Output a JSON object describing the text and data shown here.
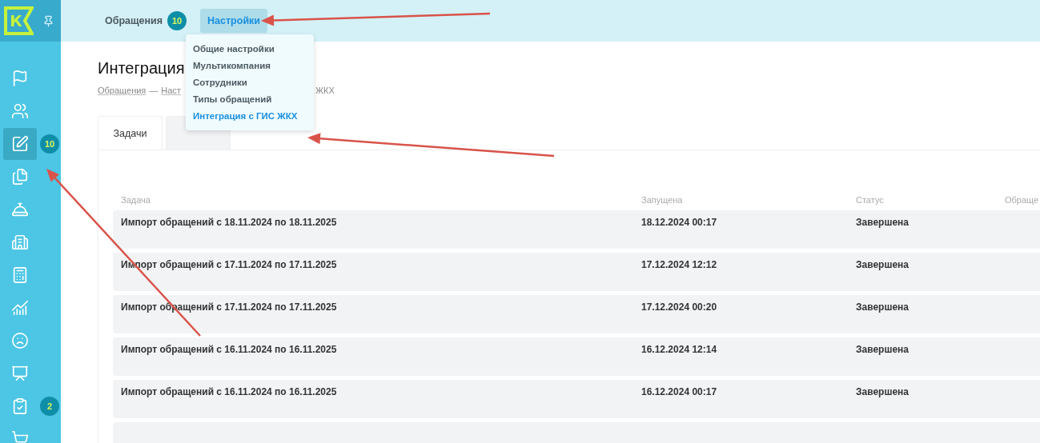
{
  "logo": {
    "letter": "К"
  },
  "sidebar": {
    "items": [
      {
        "selected": false
      },
      {
        "selected": false
      },
      {
        "selected": true,
        "badge": "10"
      },
      {
        "selected": false
      },
      {
        "selected": false
      },
      {
        "selected": false
      },
      {
        "selected": false
      },
      {
        "selected": false
      },
      {
        "selected": false
      },
      {
        "selected": false
      },
      {
        "selected": false,
        "badge": "2"
      },
      {
        "selected": false
      }
    ]
  },
  "top_nav": [
    {
      "label": "Обращения",
      "badge": "10",
      "selected": false
    },
    {
      "label": "Настройки",
      "selected": true
    }
  ],
  "dropdown": {
    "items": [
      {
        "label": "Общие настройки",
        "selected": false
      },
      {
        "label": "Мультикомпания",
        "selected": false
      },
      {
        "label": "Сотрудники",
        "selected": false
      },
      {
        "label": "Типы обращений",
        "selected": false
      },
      {
        "label": "Интеграция с ГИС ЖКХ",
        "selected": true
      }
    ]
  },
  "page": {
    "title": "Интеграция",
    "breadcrumbs": [
      "Обращения",
      "—",
      "Наст",
      "ЖКХ"
    ]
  },
  "tabs": [
    {
      "label": "Задачи",
      "selected": true
    },
    {
      "selected": false
    }
  ],
  "table": {
    "columns": [
      "Задача",
      "Запущена",
      "Статус",
      "Обраще"
    ],
    "rows": [
      [
        "Импорт обращений с 18.11.2024 по 18.11.2025",
        "18.12.2024 00:17",
        "Завершена"
      ],
      [
        "Импорт обращений с 17.11.2024 по 17.11.2025",
        "17.12.2024 12:12",
        "Завершена"
      ],
      [
        "Импорт обращений с 17.11.2024 по 17.11.2025",
        "17.12.2024 00:20",
        "Завершена"
      ],
      [
        "Импорт обращений с 16.11.2024 по 16.11.2025",
        "16.12.2024 12:14",
        "Завершена"
      ],
      [
        "Импорт обращений с 16.11.2024 по 16.11.2025",
        "16.12.2024 00:17",
        "Завершена"
      ]
    ]
  }
}
